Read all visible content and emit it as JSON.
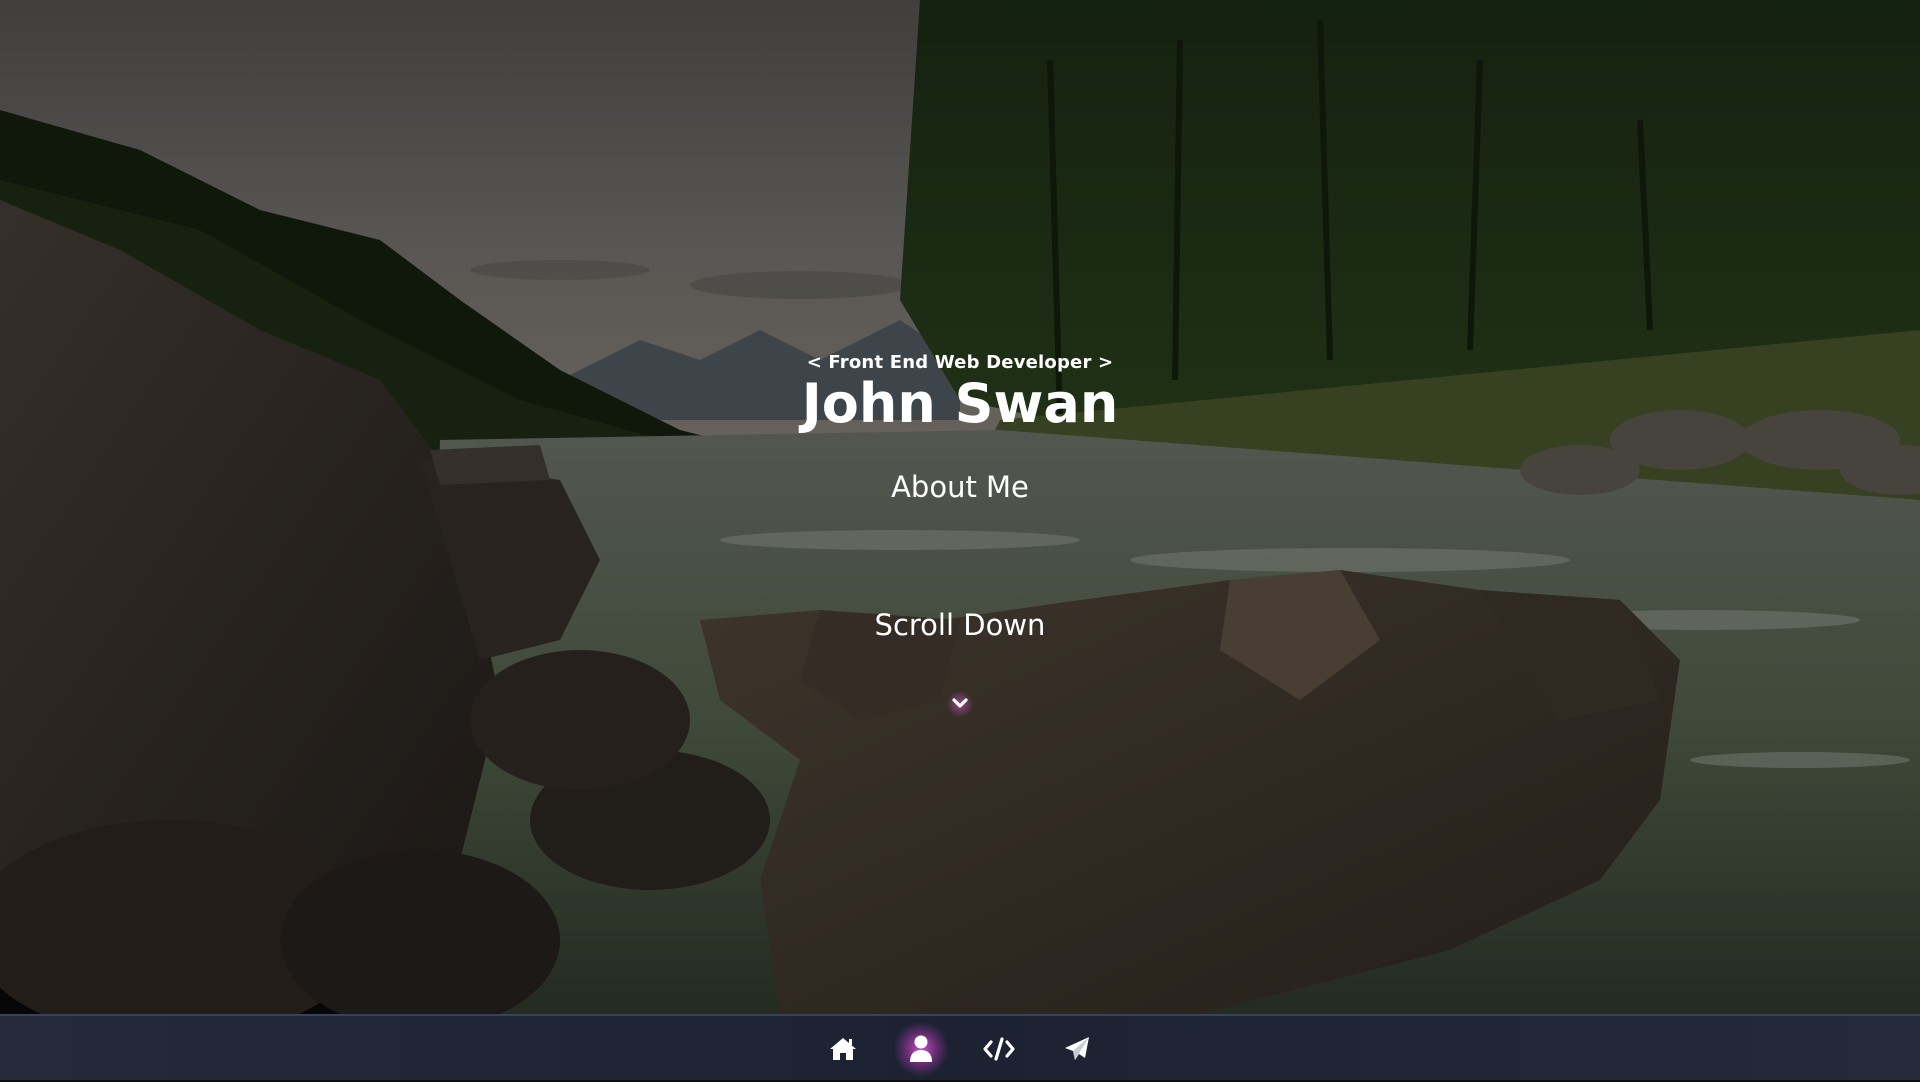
{
  "hero": {
    "subtitle": "< Front End Web Developer >",
    "name": "John Swan",
    "about_label": "About Me",
    "scroll_label": "Scroll Down",
    "scroll_icon": "chevron-down-icon"
  },
  "navbar": {
    "items": [
      {
        "icon": "home-icon",
        "active": false
      },
      {
        "icon": "user-icon",
        "active": true
      },
      {
        "icon": "code-icon",
        "active": false
      },
      {
        "icon": "paper-plane-icon",
        "active": false
      }
    ],
    "active_glow": "#e050dc"
  }
}
